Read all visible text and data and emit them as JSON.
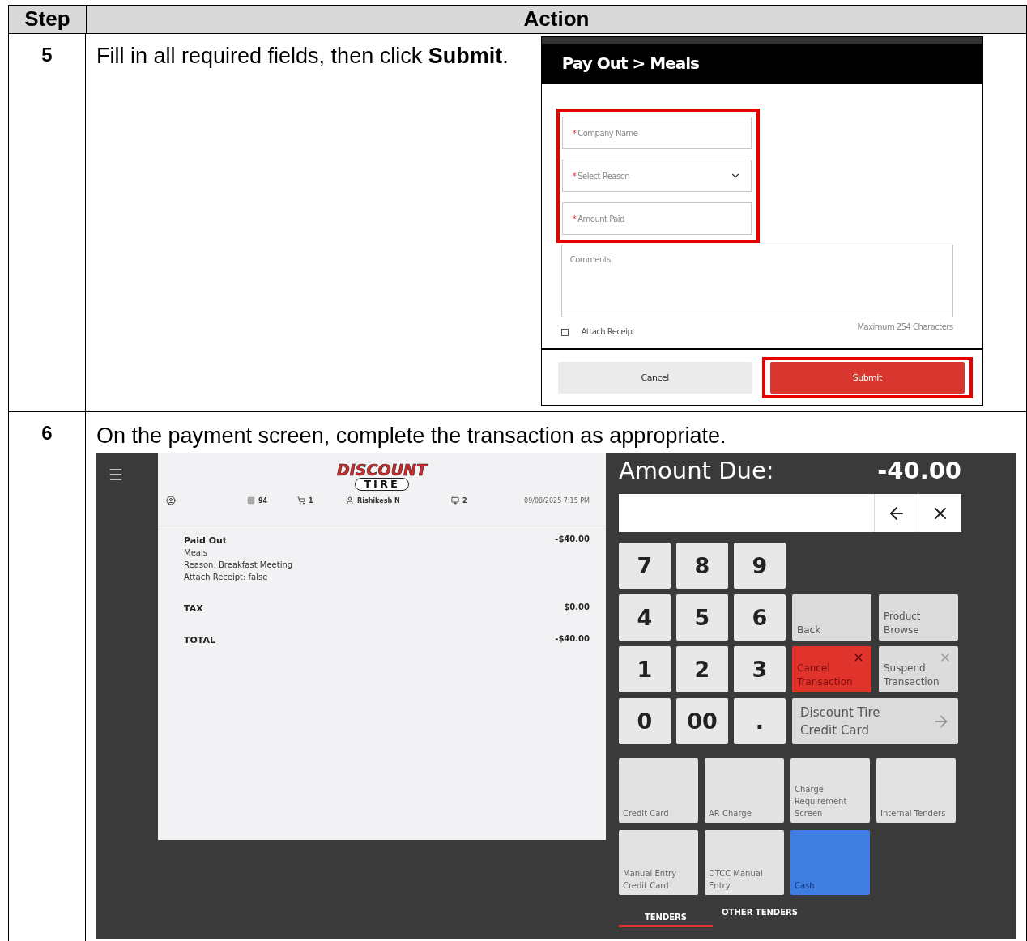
{
  "table": {
    "columns": [
      "Step",
      "Action"
    ],
    "rows": [
      {
        "step": "5",
        "instruction": "Fill in all required fields, then click **Submit**.",
        "kind": "dialog"
      },
      {
        "step": "6",
        "instruction": "On the payment screen, complete the transaction as appropriate.",
        "kind": "pos"
      }
    ]
  },
  "payout_dialog": {
    "title": "Pay Out > Meals",
    "fields_highlighted": true,
    "required_mark": "*",
    "fields": [
      {
        "placeholder": "Company Name",
        "required": true,
        "kind": "text"
      },
      {
        "placeholder": "Select Reason",
        "required": true,
        "kind": "select"
      },
      {
        "placeholder": "Amount Paid",
        "required": true,
        "kind": "text"
      }
    ],
    "comments": {
      "placeholder": "Comments",
      "note": "Maximum 254 Characters"
    },
    "attach_receipt": {
      "label": "Attach Receipt",
      "checked": false
    },
    "buttons": [
      {
        "label": "Cancel",
        "kind": "secondary",
        "highlighted": false
      },
      {
        "label": "Submit",
        "kind": "primary",
        "highlighted": true
      }
    ]
  },
  "pos_screen": {
    "logo": {
      "top": "DISCOUNT",
      "bottom": "TIRE"
    },
    "status": [
      {
        "kind": "register",
        "text": "94"
      },
      {
        "kind": "cart",
        "text": "1"
      },
      {
        "kind": "user",
        "text": "Rishikesh N"
      },
      {
        "kind": "monitor",
        "text": "2"
      },
      {
        "kind": "datetime",
        "text": "09/08/2025 7:15 PM"
      }
    ],
    "receipt": [
      {
        "title": "Paid Out",
        "details": [
          "Meals",
          "Reason: Breakfast Meeting",
          "Attach Receipt: false"
        ],
        "amount": "-$40.00"
      },
      {
        "title": "TAX",
        "amount": "$0.00"
      },
      {
        "title": "TOTAL",
        "amount": "-$40.00"
      }
    ],
    "amount_due": {
      "label": "Amount Due:",
      "value": "-40.00"
    },
    "keypad": [
      "7",
      "8",
      "9",
      "4",
      "5",
      "6",
      "1",
      "2",
      "3",
      "0",
      "00",
      "."
    ],
    "action_rows": [
      [
        {
          "label": "Back",
          "kind": "plain",
          "color": "#dcdcdc"
        },
        {
          "label": "Product Browse",
          "kind": "plain",
          "color": "#dcdcdc"
        }
      ],
      [
        {
          "label": "Cancel Transaction",
          "kind": "close",
          "color": "#e0332b"
        },
        {
          "label": "Suspend Transaction",
          "kind": "close",
          "color": "#dcdcdc"
        }
      ],
      [
        {
          "label": "Discount Tire Credit Card",
          "kind": "wide",
          "color": "#dcdcdc"
        }
      ]
    ],
    "tenders": [
      {
        "label": "Credit Card",
        "selected": false
      },
      {
        "label": "AR Charge",
        "selected": false
      },
      {
        "label": "Charge Requirement Screen",
        "selected": false
      },
      {
        "label": "Internal Tenders",
        "selected": false
      },
      {
        "label": "Manual Entry Credit Card",
        "selected": false
      },
      {
        "label": "DTCC Manual Entry",
        "selected": false
      },
      {
        "label": "Cash",
        "selected": true
      }
    ],
    "tabs": [
      {
        "label": "TENDERS",
        "selected": true
      },
      {
        "label": "OTHER TENDERS",
        "selected": false
      }
    ]
  }
}
